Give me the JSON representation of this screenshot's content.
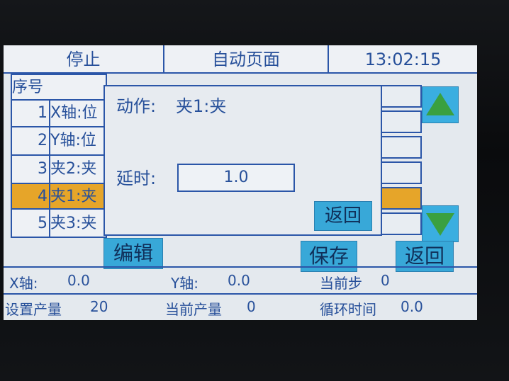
{
  "header": {
    "status": "停止",
    "page_title": "自动页面",
    "time": "13:02:15"
  },
  "table": {
    "header_label": "序号",
    "rows": [
      {
        "num": "1",
        "action": "X轴:位"
      },
      {
        "num": "2",
        "action": "Y轴:位"
      },
      {
        "num": "3",
        "action": "夹2:夹"
      },
      {
        "num": "4",
        "action": "夹1:夹"
      },
      {
        "num": "5",
        "action": "夹3:夹"
      }
    ],
    "selected_row": 4
  },
  "dialog": {
    "action_label": "动作:",
    "action_value": "夹1:夹",
    "delay_label": "延时:",
    "delay_value": "1.0",
    "back_label": "返回"
  },
  "buttons": {
    "edit": "编辑",
    "save": "保存",
    "back": "返回"
  },
  "status_row1": {
    "x_label": "X轴:",
    "x_value": "0.0",
    "y_label": "Y轴:",
    "y_value": "0.0",
    "step_label": "当前步",
    "step_value": "0"
  },
  "status_row2": {
    "set_output_label": "设置产量",
    "set_output_value": "20",
    "cur_output_label": "当前产量",
    "cur_output_value": "0",
    "cycle_label": "循环时间",
    "cycle_value": "0.0"
  },
  "colors": {
    "accent": "#38a8d8",
    "selected": "#e6a529",
    "text": "#27509a",
    "arrow": "#3aa040"
  },
  "icons": [
    "arrow-up-icon",
    "arrow-down-icon"
  ]
}
